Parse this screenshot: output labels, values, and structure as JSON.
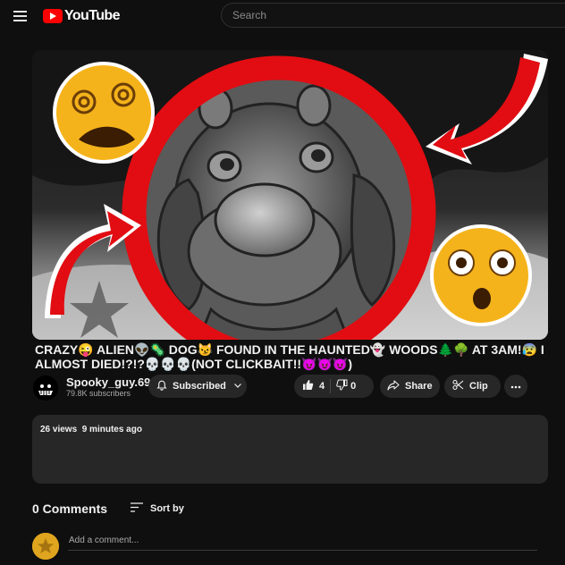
{
  "header": {
    "logo_text": "YouTube",
    "search_placeholder": "Search"
  },
  "video": {
    "title": "CRAZY😜 ALIEN👽🦠 DOG😼 FOUND IN THE HAUNTED👻 WOODS🌲🌳 AT 3AM!😰 I ALMOST DIED!?!?💀💀💀(NOT CLICKBAIT!!😈😈😈)",
    "thumbnail_emoji_left": "😵‍💫",
    "thumbnail_emoji_right": "😳"
  },
  "channel": {
    "name": "Spooky_guy.69",
    "subscribers": "79.8K subscribers",
    "subscribe_label": "Subscribed"
  },
  "actions": {
    "likes": "4",
    "dislikes": "0",
    "share_label": "Share",
    "clip_label": "Clip"
  },
  "description": {
    "views": "26 views",
    "time": "9 minutes ago"
  },
  "comments": {
    "count_label": "0 Comments",
    "sort_label": "Sort by",
    "add_placeholder": "Add a comment..."
  },
  "colors": {
    "background": "#0f0f0f",
    "surface": "#272727",
    "brand": "#ff0000",
    "text": "#f1f1f1",
    "secondary_text": "#aaaaaa",
    "avatar_accent": "#e0a51e"
  },
  "icons": [
    "menu-icon",
    "youtube-logo-icon",
    "bell-icon",
    "chevron-down-icon",
    "like-icon",
    "dislike-icon",
    "share-icon",
    "clip-icon",
    "more-icon",
    "sort-icon",
    "star-icon"
  ]
}
